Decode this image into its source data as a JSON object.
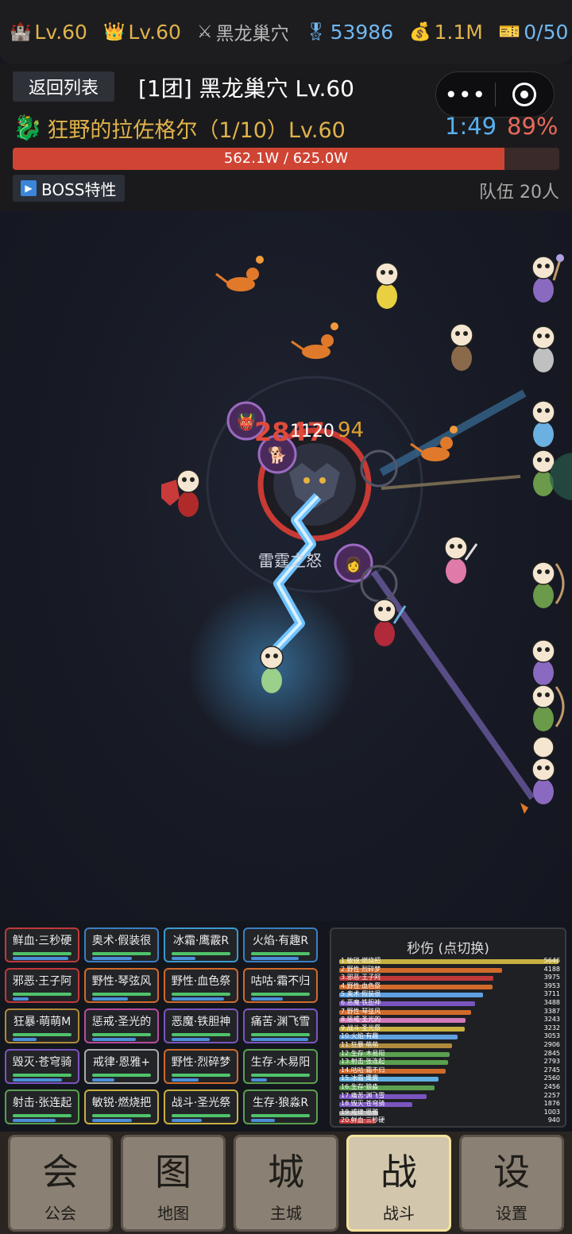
{
  "top_stats": [
    {
      "icon": "castle-icon",
      "glyph": "🏰",
      "text": "Lv.60",
      "style": "lv"
    },
    {
      "icon": "crown-icon",
      "glyph": "👑",
      "text": "Lv.60",
      "style": "lv"
    },
    {
      "icon": "crossed-swords-icon",
      "glyph": "⚔",
      "text": "黑龙巢穴",
      "style": "gray"
    },
    {
      "icon": "medal-icon",
      "glyph": "🎖",
      "text": "53986",
      "style": "blue"
    },
    {
      "icon": "money-bag-icon",
      "glyph": "💰",
      "text": "1.1M",
      "style": "lv"
    },
    {
      "icon": "ticket-icon",
      "glyph": "🎫",
      "text": "0/50",
      "style": "blue"
    }
  ],
  "header": {
    "back_label": "返回列表",
    "raid_title": "[1团] 黑龙巢穴 Lv.60",
    "boss_name": "狂野的拉佐格尔（1/10）Lv.60",
    "timer": "1:49",
    "percent": "89%",
    "hp_text": "562.1W / 625.0W",
    "hp_fraction": 0.899,
    "traits_label": "BOSS特性",
    "team_label": "队伍 20人"
  },
  "battle": {
    "damage_text": "2847",
    "damage_text2": "1120",
    "damage_text3": "94",
    "skill_text": "雷霆之怒"
  },
  "skills": [
    {
      "label": "鲜血·三秒硬",
      "color": "#c0393a"
    },
    {
      "label": "奥术·假装很",
      "color": "#3a7fc4"
    },
    {
      "label": "冰霜·鹰霰R",
      "color": "#3a9ad0"
    },
    {
      "label": "火焰·有趣R",
      "color": "#3a7fc4"
    },
    {
      "label": "邪恶·王子阿",
      "color": "#c0393a"
    },
    {
      "label": "野性·琴弦风",
      "color": "#d06a2a"
    },
    {
      "label": "野性·血色祭",
      "color": "#d06a2a"
    },
    {
      "label": "咕咕·霜不归",
      "color": "#d06a2a"
    },
    {
      "label": "狂暴·萌萌M",
      "color": "#b08a3c"
    },
    {
      "label": "惩戒·圣光的",
      "color": "#b84aa0"
    },
    {
      "label": "恶魔·铁胆神",
      "color": "#7a55c0"
    },
    {
      "label": "痛苦·渊飞雪",
      "color": "#7a55c0"
    },
    {
      "label": "毁灭·苍穹骑",
      "color": "#7a55c0"
    },
    {
      "label": "戒律·恩雅+",
      "color": "#aaaaaa"
    },
    {
      "label": "野性·烈碎梦",
      "color": "#d06a2a"
    },
    {
      "label": "生存·木易阳",
      "color": "#5aa050"
    },
    {
      "label": "射击·张连起",
      "color": "#5aa050"
    },
    {
      "label": "敏锐·燃烧把",
      "color": "#c8b040"
    },
    {
      "label": "战斗·圣光祭",
      "color": "#c8b040"
    },
    {
      "label": "生存·狼淼R",
      "color": "#5aa050"
    }
  ],
  "dps": {
    "title": "秒伤 (点切换)",
    "rows": [
      {
        "name": "1.敏锐·燃烧把",
        "value": "5646",
        "color": "#c8b040"
      },
      {
        "name": "2.野性·烈碎梦",
        "value": "4188",
        "color": "#d06a2a"
      },
      {
        "name": "3.邪恶·王子阿",
        "value": "3975",
        "color": "#c0393a"
      },
      {
        "name": "4.野性·血色祭",
        "value": "3953",
        "color": "#d06a2a"
      },
      {
        "name": "5.奥术·假装很",
        "value": "3711",
        "color": "#5fa0e0"
      },
      {
        "name": "6.恶魔·铁胆神",
        "value": "3488",
        "color": "#7a55c0"
      },
      {
        "name": "7.野性·琴弦风",
        "value": "3387",
        "color": "#d06a2a"
      },
      {
        "name": "8.惩戒·圣光的",
        "value": "3243",
        "color": "#d07ab8"
      },
      {
        "name": "9.战斗·圣光祭",
        "value": "3232",
        "color": "#c8b040"
      },
      {
        "name": "10.火焰·有趣",
        "value": "3053",
        "color": "#5fa0e0"
      },
      {
        "name": "11.狂暴·萌萌",
        "value": "2906",
        "color": "#b08a3c"
      },
      {
        "name": "12.生存·木易阳",
        "value": "2845",
        "color": "#5aa050"
      },
      {
        "name": "13.射击·张连起",
        "value": "2793",
        "color": "#5aa050"
      },
      {
        "name": "14.咕咕·霜不归",
        "value": "2745",
        "color": "#d06a2a"
      },
      {
        "name": "15.冰霜·鹰霰",
        "value": "2560",
        "color": "#5fb0e0"
      },
      {
        "name": "16.生存·狼淼",
        "value": "2456",
        "color": "#5aa050"
      },
      {
        "name": "17.痛苦·渊飞雪",
        "value": "2257",
        "color": "#7a55c0"
      },
      {
        "name": "18.毁灭·苍穹骑",
        "value": "1876",
        "color": "#7a55c0"
      },
      {
        "name": "19.戒律·恩雅",
        "value": "1003",
        "color": "#aaaaaa"
      },
      {
        "name": "20.鲜血·三秒硬",
        "value": "940",
        "color": "#c0393a"
      }
    ]
  },
  "nav": [
    {
      "big": "会",
      "small": "公会",
      "active": false
    },
    {
      "big": "图",
      "small": "地图",
      "active": false
    },
    {
      "big": "城",
      "small": "主城",
      "active": false
    },
    {
      "big": "战",
      "small": "战斗",
      "active": true
    },
    {
      "big": "设",
      "small": "设置",
      "active": false
    }
  ]
}
